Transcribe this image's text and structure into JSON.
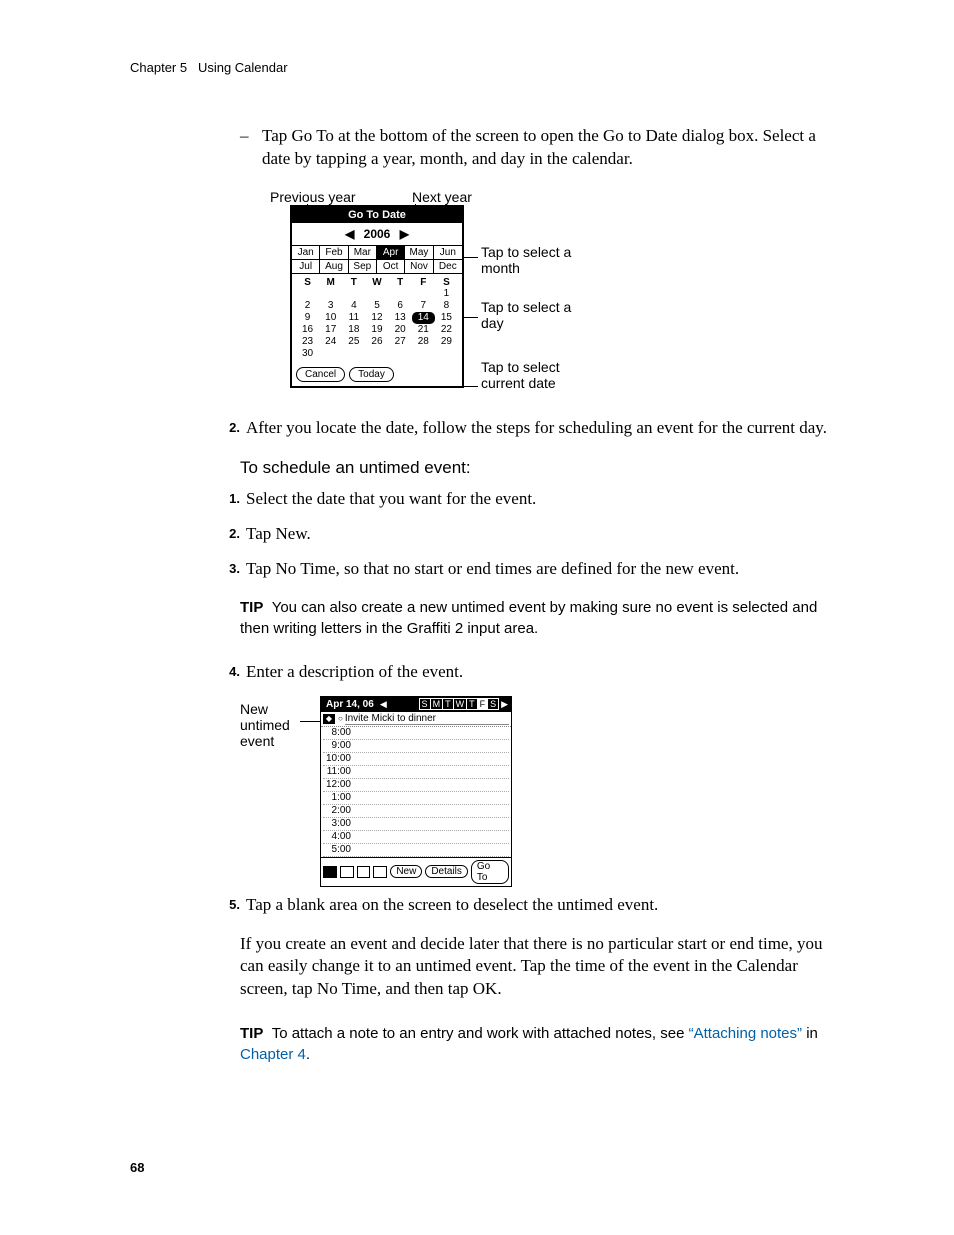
{
  "header": {
    "chapter": "Chapter 5",
    "title": "Using Calendar"
  },
  "page_number": "68",
  "body": {
    "goto_para": "Tap Go To at the bottom of the screen to open the Go to Date dialog box. Select a date by tapping a year, month, and day in the calendar.",
    "step2_after": "After you locate the date, follow the steps for scheduling an event for the current day.",
    "untimed_heading": "To schedule an untimed event:",
    "u_step1": "Select the date that you want for the event.",
    "u_step2": "Tap New.",
    "u_step3": "Tap No Time, so that no start or end times are defined for the new event.",
    "tip1_label": "TIP",
    "tip1_text": "You can also create a new untimed event by making sure no event is selected and then writing letters in the Graffiti 2 input area.",
    "u_step4": "Enter a description of the event.",
    "u_step5": "Tap a blank area on the screen to deselect the untimed event.",
    "closing": "If you create an event and decide later that there is no particular start or end time, you can easily change it to an untimed event. Tap the time of the event in the Calendar screen, tap No Time, and then tap OK.",
    "tip2_label": "TIP",
    "tip2_pre": "To attach a note to an entry and work with attached notes, see ",
    "tip2_link1": "“Attaching notes”",
    "tip2_mid": " in ",
    "tip2_link2": "Chapter 4",
    "tip2_end": "."
  },
  "numbers": {
    "n2": "2.",
    "u1": "1.",
    "u2": "2.",
    "u3": "3.",
    "u4": "4.",
    "u5": "5."
  },
  "fig1": {
    "lbl_prev": "Previous year",
    "lbl_next": "Next year",
    "lbl_month": "Tap to select a month",
    "lbl_day": "Tap to select a day",
    "lbl_today": "Tap to select current date",
    "dialog_title": "Go To Date",
    "year": "2006",
    "months": [
      "Jan",
      "Feb",
      "Mar",
      "Apr",
      "May",
      "Jun",
      "Jul",
      "Aug",
      "Sep",
      "Oct",
      "Nov",
      "Dec"
    ],
    "selected_month": "Apr",
    "dow": [
      "S",
      "M",
      "T",
      "W",
      "T",
      "F",
      "S"
    ],
    "days": [
      "",
      "",
      "",
      "",
      "",
      "",
      "1",
      "2",
      "3",
      "4",
      "5",
      "6",
      "7",
      "8",
      "9",
      "10",
      "11",
      "12",
      "13",
      "14",
      "15",
      "16",
      "17",
      "18",
      "19",
      "20",
      "21",
      "22",
      "23",
      "24",
      "25",
      "26",
      "27",
      "28",
      "29",
      "30",
      "",
      "",
      "",
      "",
      "",
      ""
    ],
    "selected_day": "14",
    "btn_cancel": "Cancel",
    "btn_today": "Today"
  },
  "fig2": {
    "label": "New untimed event",
    "date": "Apr 14, 06",
    "dow": [
      "S",
      "M",
      "T",
      "W",
      "T",
      "F",
      "S"
    ],
    "selected_dow": "F",
    "untimed_event": "Invite Micki to dinner",
    "times": [
      "8:00",
      "9:00",
      "10:00",
      "11:00",
      "12:00",
      "1:00",
      "2:00",
      "3:00",
      "4:00",
      "5:00"
    ],
    "btn_new": "New",
    "btn_details": "Details",
    "btn_goto": "Go To"
  }
}
